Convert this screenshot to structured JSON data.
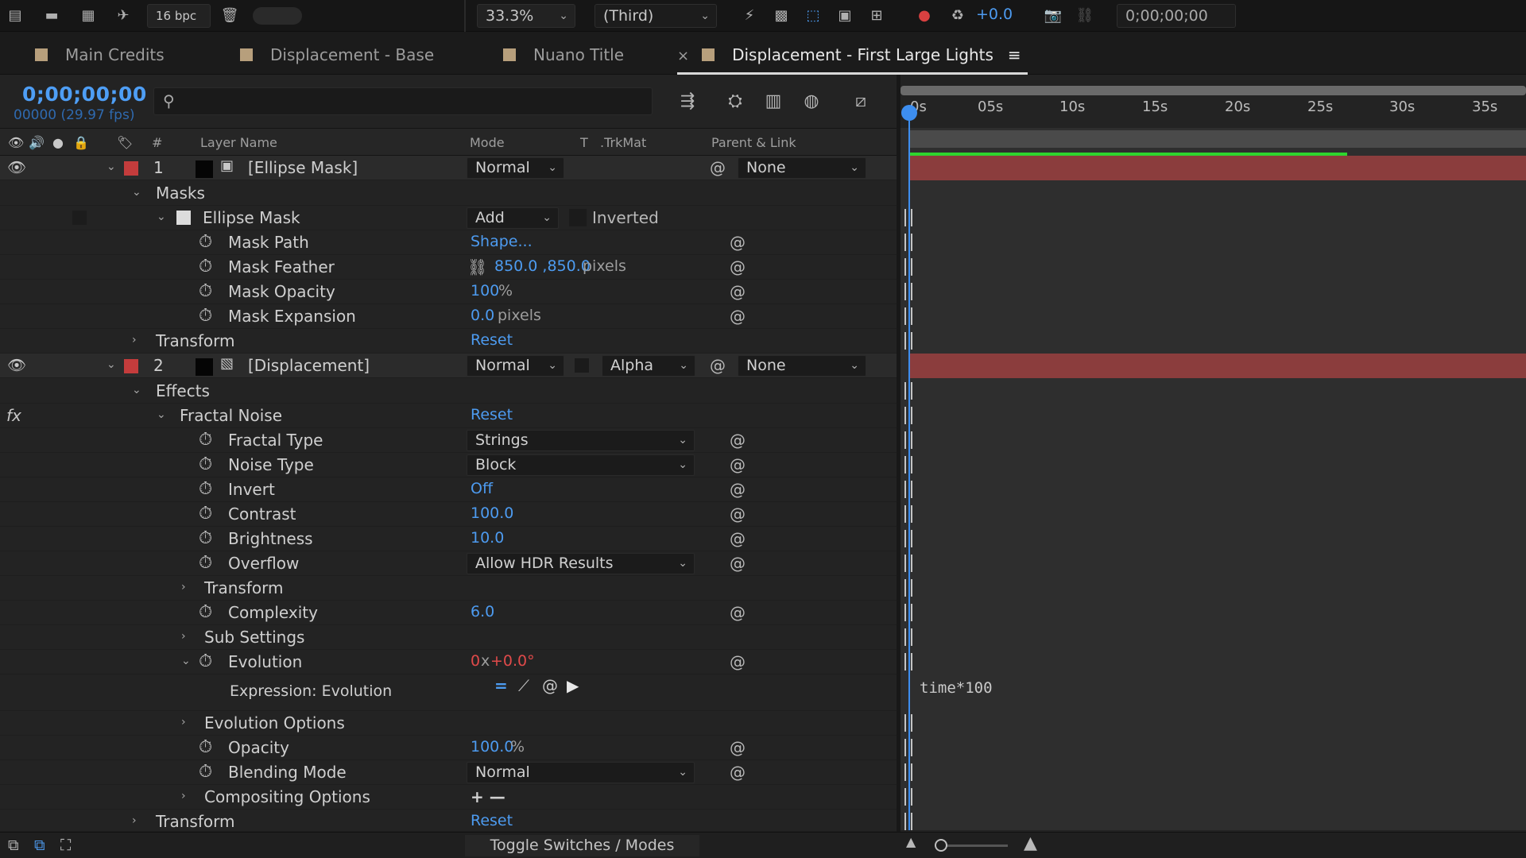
{
  "toolbar": {
    "bpc": "16 bpc",
    "zoom": "33.3%",
    "resolution": "(Third)",
    "exposure": "+0.0",
    "timecode": "0;00;00;00"
  },
  "tabs": [
    {
      "label": "Main Credits"
    },
    {
      "label": "Displacement - Base"
    },
    {
      "label": "Nuano Title"
    },
    {
      "label": "Displacement - First Large Lights",
      "close": "×",
      "menu": "≡"
    }
  ],
  "comp": {
    "timecode": "0;00;00;00",
    "frames": "00000 (29.97 fps)"
  },
  "columns": {
    "number": "#",
    "layer_name": "Layer Name",
    "mode": "Mode",
    "t": "T",
    "trkmat": ".TrkMat",
    "parent": "Parent & Link"
  },
  "layers": [
    {
      "number": "1",
      "name": "[Ellipse Mask]",
      "mode": "Normal",
      "parent": "None"
    },
    {
      "number": "2",
      "name": "[Displacement]",
      "mode": "Normal",
      "trkmat": "Alpha",
      "parent": "None"
    }
  ],
  "rows": {
    "masks": "Masks",
    "ellipse_mask": "Ellipse Mask",
    "mask_mode": "Add",
    "inverted": "Inverted",
    "mask_path": "Mask Path",
    "mask_path_val": "Shape...",
    "mask_feather": "Mask Feather",
    "mask_feather_val": "850.0 ,850.0",
    "mask_feather_unit": "pixels",
    "mask_opacity": "Mask Opacity",
    "mask_opacity_val": "100",
    "mask_opacity_unit": "%",
    "mask_expansion": "Mask Expansion",
    "mask_expansion_val": "0.0",
    "mask_expansion_unit": "pixels",
    "transform1": "Transform",
    "reset": "Reset",
    "effects": "Effects",
    "fx": "fx",
    "fractal_noise": "Fractal Noise",
    "fractal_type": "Fractal Type",
    "fractal_type_val": "Strings",
    "noise_type": "Noise Type",
    "noise_type_val": "Block",
    "invert": "Invert",
    "invert_val": "Off",
    "contrast": "Contrast",
    "contrast_val": "100.0",
    "brightness": "Brightness",
    "brightness_val": "10.0",
    "overflow": "Overflow",
    "overflow_val": "Allow HDR Results",
    "transform_fx": "Transform",
    "complexity": "Complexity",
    "complexity_val": "6.0",
    "sub_settings": "Sub Settings",
    "evolution": "Evolution",
    "evolution_rev": "0",
    "evolution_x": "x",
    "evolution_deg": "+0.0°",
    "expression_evolution": "Expression: Evolution",
    "expression_text": "time*100",
    "evolution_options": "Evolution Options",
    "opacity": "Opacity",
    "opacity_val": "100.0",
    "opacity_unit": "%",
    "blending_mode": "Blending Mode",
    "blending_mode_val": "Normal",
    "compositing_options": "Compositing Options",
    "plus_minus": "+ —",
    "transform2": "Transform"
  },
  "timeline": {
    "ticks": [
      "0s",
      "05s",
      "10s",
      "15s",
      "20s",
      "25s",
      "30s",
      "35s"
    ]
  },
  "bottom": {
    "toggle": "Toggle Switches / Modes"
  },
  "colors": {
    "accent_blue": "#4d9bf0",
    "label_red": "#c43c3c",
    "layer_bar": "#8b3d3d",
    "work_area_green": "#2ed52e",
    "evolution_red": "#e04a4a"
  }
}
